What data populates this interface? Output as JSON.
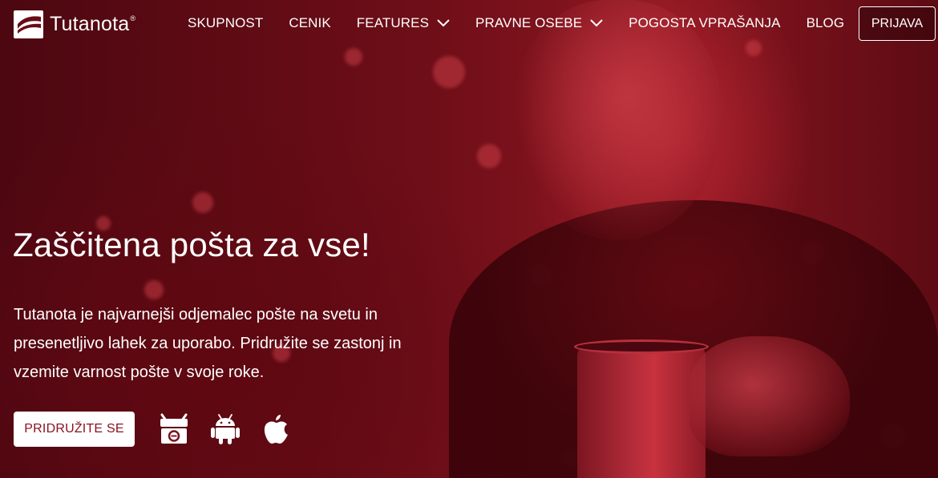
{
  "brand": {
    "logo_text": "Tutanota",
    "trademark": "®",
    "accent_color": "#8a1220"
  },
  "nav": {
    "items": [
      {
        "label": "SKUPNOST",
        "dropdown": false
      },
      {
        "label": "CENIK",
        "dropdown": false
      },
      {
        "label": "FEATURES",
        "dropdown": true
      },
      {
        "label": "PRAVNE OSEBE",
        "dropdown": true
      },
      {
        "label": "POGOSTA VPRAŠANJA",
        "dropdown": false
      },
      {
        "label": "BLOG",
        "dropdown": false
      }
    ],
    "login_label": "PRIJAVA"
  },
  "hero": {
    "title": "Zaščitena pošta za vse!",
    "description": "Tutanota je najvarnejši odjemalec pošte na svetu in presenetljivo lahek za uporabo. Pridružite se zastonj in vzemite varnost pošte v svoje roke.",
    "cta_label": "PRIDRUŽITE SE",
    "app_icons": [
      "f-droid-icon",
      "android-icon",
      "apple-icon"
    ]
  }
}
